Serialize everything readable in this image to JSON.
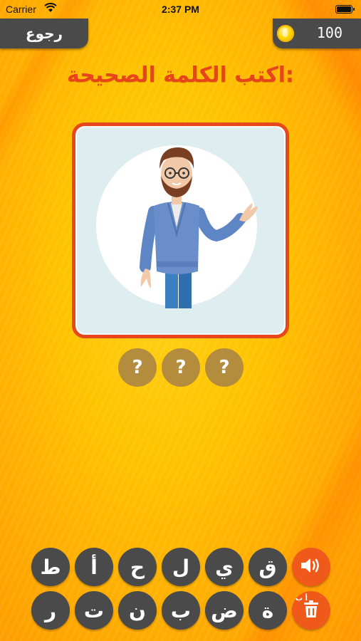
{
  "status_bar": {
    "carrier": "Carrier",
    "time": "2:37 PM",
    "battery_level": 1.0
  },
  "header": {
    "back_label": "رجوع",
    "coins": "100"
  },
  "title": "اكتب الكلمة الصحيحة:",
  "answer_slots": [
    "?",
    "?",
    "?"
  ],
  "keyboard": {
    "row1": [
      "ق",
      "ي",
      "ل",
      "ح",
      "أ",
      "ط"
    ],
    "row2": [
      "ة",
      "ض",
      "ب",
      "ن",
      "ت",
      "ر"
    ],
    "sound_icon": "speaker-icon",
    "delete_icon": "trash-icon",
    "delete_mini_label": "أ ب"
  },
  "colors": {
    "accent": "#e8441c",
    "button_dark": "#4a4a4a",
    "slot": "#b48c3e",
    "action": "#ef5a1a"
  }
}
